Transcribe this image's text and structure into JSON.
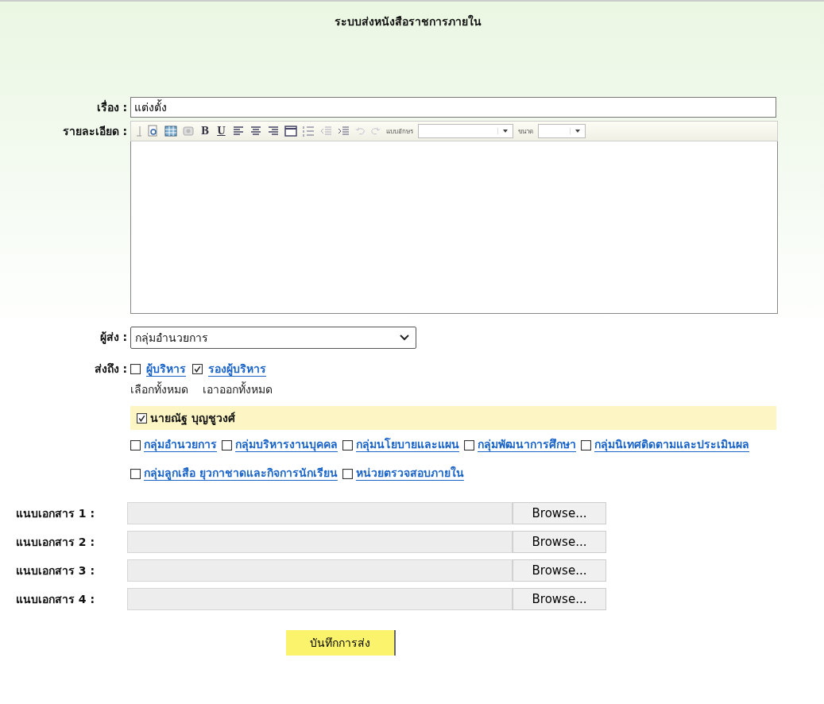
{
  "title": "ระบบส่งหนังสือราชการภายใน",
  "subject": {
    "label": "เรื่อง :",
    "value": "แต่งตั้ง"
  },
  "details": {
    "label": "รายละเอียด :",
    "toolbar": {
      "bold": "B",
      "underline": "U",
      "font_label": "แบบอักษร",
      "size_label": "ขนาด"
    }
  },
  "sender": {
    "label": "ผู้ส่ง :",
    "value": "กลุ่มอำนวยการ"
  },
  "recipients": {
    "label": "ส่งถึง :",
    "roles": [
      {
        "label": "ผู้บริหาร",
        "checked": false
      },
      {
        "label": "รองผู้บริหาร",
        "checked": true
      }
    ],
    "select_all": "เลือกทั้งหมด",
    "deselect_all": "เอาออกทั้งหมด",
    "people": [
      {
        "label": "นายณัฐ บุญชูวงศ์",
        "checked": true
      }
    ],
    "groups": [
      {
        "label": "กลุ่มอำนวยการ",
        "checked": false
      },
      {
        "label": "กลุ่มบริหารงานบุคคล",
        "checked": false
      },
      {
        "label": "กลุ่มนโยบายและแผน",
        "checked": false
      },
      {
        "label": "กลุ่มพัฒนาการศึกษา",
        "checked": false
      },
      {
        "label": "กลุ่มนิเทศติดตามและประเมินผล",
        "checked": false
      },
      {
        "label": "กลุ่มลูกเสือ ยุวกาชาดและกิจการนักเรียน",
        "checked": false
      },
      {
        "label": "หน่วยตรวจสอบภายใน",
        "checked": false
      }
    ]
  },
  "attachments": [
    {
      "label": "แนบเอกสาร 1 :",
      "button": "Browse..."
    },
    {
      "label": "แนบเอกสาร 2 :",
      "button": "Browse..."
    },
    {
      "label": "แนบเอกสาร 3 :",
      "button": "Browse..."
    },
    {
      "label": "แนบเอกสาร 4 :",
      "button": "Browse..."
    }
  ],
  "submit": "บันทึกการส่ง"
}
